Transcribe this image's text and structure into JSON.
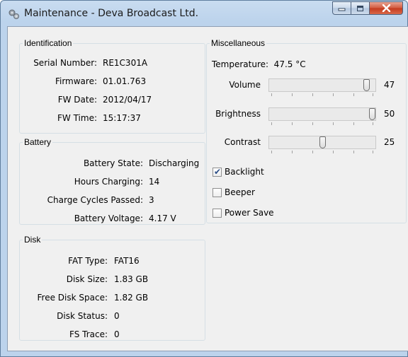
{
  "window": {
    "title": "Maintenance - Deva Broadcast Ltd."
  },
  "identification": {
    "legend": "Identification",
    "serial_label": "Serial Number:",
    "serial_value": "RE1C301A",
    "firmware_label": "Firmware:",
    "firmware_value": "01.01.763",
    "fw_date_label": "FW Date:",
    "fw_date_value": "2012/04/17",
    "fw_time_label": "FW Time:",
    "fw_time_value": "15:17:37"
  },
  "battery": {
    "legend": "Battery",
    "state_label": "Battery State:",
    "state_value": "Discharging",
    "hours_label": "Hours Charging:",
    "hours_value": "14",
    "cycles_label": "Charge Cycles Passed:",
    "cycles_value": "3",
    "voltage_label": "Battery Voltage:",
    "voltage_value": "4.17 V"
  },
  "disk": {
    "legend": "Disk",
    "fat_label": "FAT Type:",
    "fat_value": "FAT16",
    "size_label": "Disk Size:",
    "size_value": "1.83 GB",
    "free_label": "Free Disk Space:",
    "free_value": "1.82 GB",
    "status_label": "Disk Status:",
    "status_value": "0",
    "trace_label": "FS Trace:",
    "trace_value": "0"
  },
  "misc": {
    "legend": "Miscellaneous",
    "temperature": "Temperature:  47.5 °C",
    "volume_label": "Volume",
    "volume_value": "47",
    "volume_level": 0.94,
    "brightness_label": "Brightness",
    "brightness_value": "50",
    "brightness_level": 1.0,
    "contrast_label": "Contrast",
    "contrast_value": "25",
    "contrast_level": 0.5,
    "backlight_label": "Backlight",
    "backlight_checked": true,
    "beeper_label": "Beeper",
    "beeper_checked": false,
    "powersave_label": "Power Save",
    "powersave_checked": false
  },
  "colors": {
    "frame": "#bcd3ec",
    "client": "#f0f0f0",
    "close_button": "#c4391d"
  },
  "icons": [
    "maintenance-gears-icon",
    "minimize-icon",
    "maximize-icon",
    "close-icon",
    "check-icon"
  ]
}
